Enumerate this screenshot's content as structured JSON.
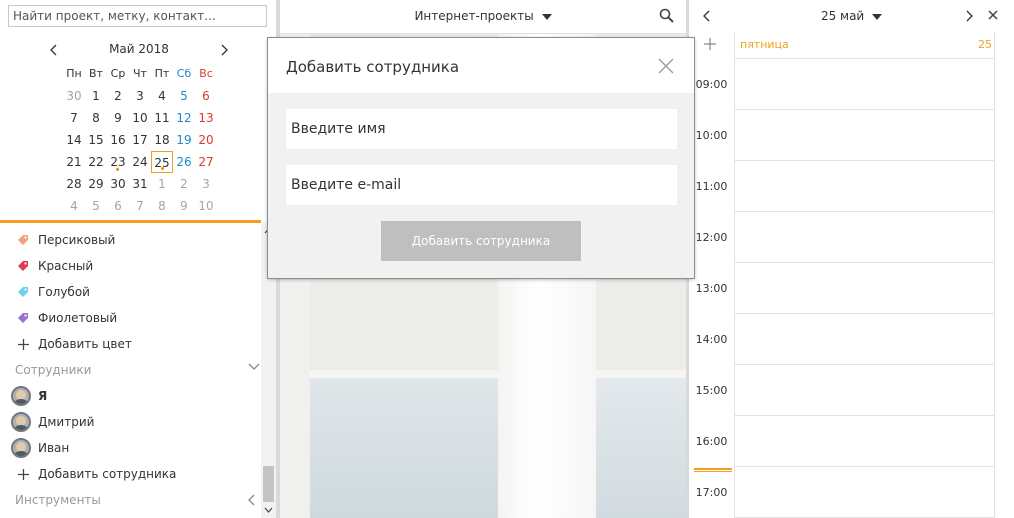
{
  "search": {
    "placeholder": "Найти проект, метку, контакт..."
  },
  "calendar": {
    "title": "Май 2018",
    "weekdays": [
      "Пн",
      "Вт",
      "Ср",
      "Чт",
      "Пт",
      "Сб",
      "Вс"
    ],
    "weeks": [
      [
        "30",
        "1",
        "2",
        "3",
        "4",
        "5",
        "6"
      ],
      [
        "7",
        "8",
        "9",
        "10",
        "11",
        "12",
        "13"
      ],
      [
        "14",
        "15",
        "16",
        "17",
        "18",
        "19",
        "20"
      ],
      [
        "21",
        "22",
        "23",
        "24",
        "25",
        "26",
        "27"
      ],
      [
        "28",
        "29",
        "30",
        "31",
        "1",
        "2",
        "3"
      ],
      [
        "4",
        "5",
        "6",
        "7",
        "8",
        "9",
        "10"
      ]
    ],
    "today": "25"
  },
  "colors": {
    "items": [
      {
        "label": "Персиковый",
        "color": "#f2a37a"
      },
      {
        "label": "Красный",
        "color": "#e23b4b"
      },
      {
        "label": "Голубой",
        "color": "#6cd2ea"
      },
      {
        "label": "Фиолетовый",
        "color": "#9b6fd3"
      }
    ],
    "add_label": "Добавить цвет"
  },
  "employees": {
    "section_label": "Сотрудники",
    "items": [
      {
        "label": "Я"
      },
      {
        "label": "Дмитрий"
      },
      {
        "label": "Иван"
      }
    ],
    "add_label": "Добавить сотрудника"
  },
  "tools": {
    "section_label": "Инструменты"
  },
  "middle": {
    "title": "Интернет-проекты"
  },
  "modal": {
    "title": "Добавить сотрудника",
    "name_placeholder": "Введите имя",
    "email_placeholder": "Введите e-mail",
    "submit_label": "Добавить сотрудника"
  },
  "day_view": {
    "title": "25 май",
    "day_name": "пятница",
    "day_number": "25",
    "hours": [
      "09:00",
      "10:00",
      "11:00",
      "12:00",
      "13:00",
      "14:00",
      "15:00",
      "16:00",
      "17:00"
    ]
  },
  "accent_color": "#f0a020"
}
